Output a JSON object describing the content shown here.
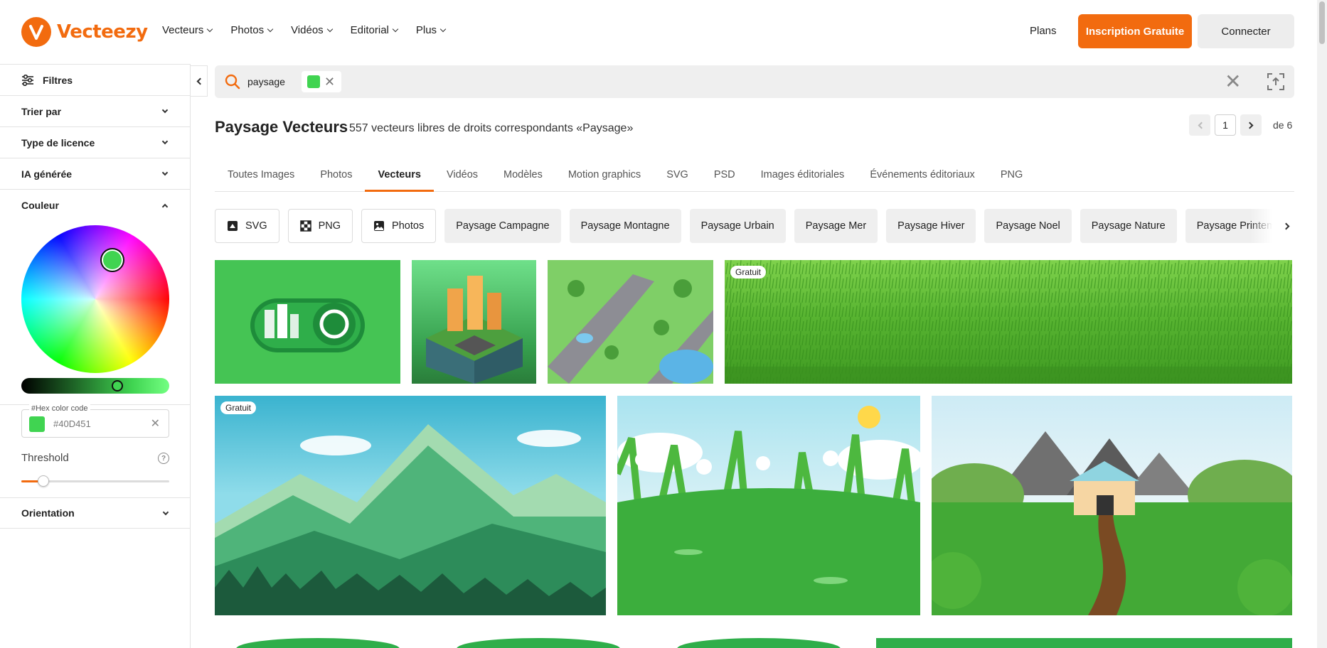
{
  "brand": {
    "name": "Vecteezy",
    "color": "#f26b0f"
  },
  "nav": [
    {
      "label": "Vecteurs"
    },
    {
      "label": "Photos"
    },
    {
      "label": "Vidéos"
    },
    {
      "label": "Editorial"
    },
    {
      "label": "Plus"
    }
  ],
  "header": {
    "plans": "Plans",
    "signup": "Inscription Gratuite",
    "login": "Connecter"
  },
  "sidebar": {
    "filters_label": "Filtres",
    "sections": [
      {
        "label": "Trier par",
        "expanded": false
      },
      {
        "label": "Type de licence",
        "expanded": false
      },
      {
        "label": "IA générée",
        "expanded": false
      },
      {
        "label": "Couleur",
        "expanded": true
      }
    ],
    "color": {
      "hex_label": "#Hex color code",
      "hex_value": "#40D451",
      "selected": "#40D451",
      "threshold_label": "Threshold",
      "help": "?"
    },
    "orientation_label": "Orientation"
  },
  "search": {
    "term": "paysage",
    "color_filter": "#40D451"
  },
  "results": {
    "title": "Paysage Vecteurs",
    "subtitle": "557 vecteurs libres de droits correspondants «Paysage»",
    "page": "1",
    "of": "de 6"
  },
  "tabs": [
    {
      "label": "Toutes Images",
      "active": false
    },
    {
      "label": "Photos",
      "active": false
    },
    {
      "label": "Vecteurs",
      "active": true
    },
    {
      "label": "Vidéos",
      "active": false
    },
    {
      "label": "Modèles",
      "active": false
    },
    {
      "label": "Motion graphics",
      "active": false
    },
    {
      "label": "SVG",
      "active": false
    },
    {
      "label": "PSD",
      "active": false
    },
    {
      "label": "Images éditoriales",
      "active": false
    },
    {
      "label": "Événements éditoriaux",
      "active": false
    },
    {
      "label": "PNG",
      "active": false
    }
  ],
  "chips": [
    {
      "label": "SVG",
      "icon": "svg-icon"
    },
    {
      "label": "PNG",
      "icon": "checkerboard-icon"
    },
    {
      "label": "Photos",
      "icon": "image-icon"
    },
    {
      "label": "Paysage Campagne"
    },
    {
      "label": "Paysage Montagne"
    },
    {
      "label": "Paysage Urbain"
    },
    {
      "label": "Paysage Mer"
    },
    {
      "label": "Paysage Hiver"
    },
    {
      "label": "Paysage Noel"
    },
    {
      "label": "Paysage Nature"
    },
    {
      "label": "Paysage Printemps"
    }
  ],
  "thumbnails": [
    {
      "subject": "eco-city-toggle",
      "badge": ""
    },
    {
      "subject": "isometric-city-block",
      "badge": ""
    },
    {
      "subject": "isometric-park",
      "badge": ""
    },
    {
      "subject": "grass-field",
      "badge": "Gratuit"
    },
    {
      "subject": "green-mountains",
      "badge": "Gratuit"
    },
    {
      "subject": "flower-meadow",
      "badge": ""
    },
    {
      "subject": "house-path-landscape",
      "badge": ""
    }
  ]
}
